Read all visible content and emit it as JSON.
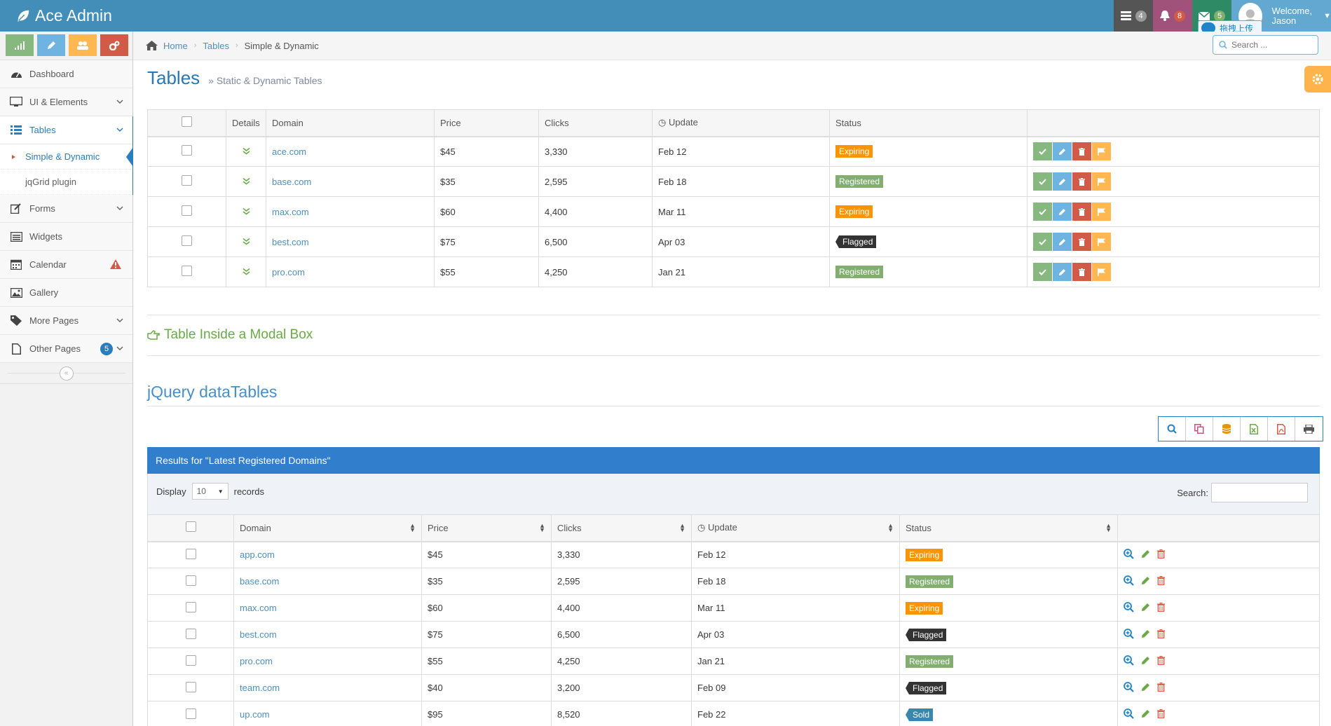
{
  "navbar": {
    "brand": "Ace Admin",
    "tasks_count": "4",
    "notifications_count": "8",
    "messages_count": "5",
    "welcome": "Welcome,",
    "username": "Jason",
    "upload_label": "拖拽上传"
  },
  "sidebar": {
    "items": [
      {
        "label": "Dashboard"
      },
      {
        "label": "UI & Elements"
      },
      {
        "label": "Tables"
      },
      {
        "label": "Forms"
      },
      {
        "label": "Widgets"
      },
      {
        "label": "Calendar"
      },
      {
        "label": "Gallery"
      },
      {
        "label": "More Pages"
      },
      {
        "label": "Other Pages",
        "badge": "5"
      }
    ],
    "tables_sub": [
      {
        "label": "Simple & Dynamic"
      },
      {
        "label": "jqGrid plugin"
      }
    ]
  },
  "breadcrumb": {
    "home": "Home",
    "tables": "Tables",
    "current": "Simple & Dynamic"
  },
  "search": {
    "placeholder": "Search ..."
  },
  "page": {
    "title": "Tables",
    "subtitle": "» Static & Dynamic Tables"
  },
  "simple_table": {
    "headers": [
      "Details",
      "Domain",
      "Price",
      "Clicks",
      "Update",
      "Status"
    ],
    "rows": [
      {
        "domain": "ace.com",
        "price": "$45",
        "clicks": "3,330",
        "update": "Feb 12",
        "status": "Expiring"
      },
      {
        "domain": "base.com",
        "price": "$35",
        "clicks": "2,595",
        "update": "Feb 18",
        "status": "Registered"
      },
      {
        "domain": "max.com",
        "price": "$60",
        "clicks": "4,400",
        "update": "Mar 11",
        "status": "Expiring"
      },
      {
        "domain": "best.com",
        "price": "$75",
        "clicks": "6,500",
        "update": "Apr 03",
        "status": "Flagged"
      },
      {
        "domain": "pro.com",
        "price": "$55",
        "clicks": "4,250",
        "update": "Jan 21",
        "status": "Registered"
      }
    ]
  },
  "modal_link": "Table Inside a Modal Box",
  "datatables": {
    "section_title": "jQuery dataTables",
    "results_header": "Results for \"Latest Registered Domains\"",
    "display_label": "Display",
    "records_label": "records",
    "page_length": "10",
    "search_label": "Search:",
    "headers": [
      "Domain",
      "Price",
      "Clicks",
      "Update",
      "Status"
    ],
    "rows": [
      {
        "domain": "app.com",
        "price": "$45",
        "clicks": "3,330",
        "update": "Feb 12",
        "status": "Expiring"
      },
      {
        "domain": "base.com",
        "price": "$35",
        "clicks": "2,595",
        "update": "Feb 18",
        "status": "Registered"
      },
      {
        "domain": "max.com",
        "price": "$60",
        "clicks": "4,400",
        "update": "Mar 11",
        "status": "Expiring"
      },
      {
        "domain": "best.com",
        "price": "$75",
        "clicks": "6,500",
        "update": "Apr 03",
        "status": "Flagged"
      },
      {
        "domain": "pro.com",
        "price": "$55",
        "clicks": "4,250",
        "update": "Jan 21",
        "status": "Registered"
      },
      {
        "domain": "team.com",
        "price": "$40",
        "clicks": "3,200",
        "update": "Feb 09",
        "status": "Flagged"
      },
      {
        "domain": "up.com",
        "price": "$95",
        "clicks": "8,520",
        "update": "Feb 22",
        "status": "Sold"
      }
    ]
  }
}
